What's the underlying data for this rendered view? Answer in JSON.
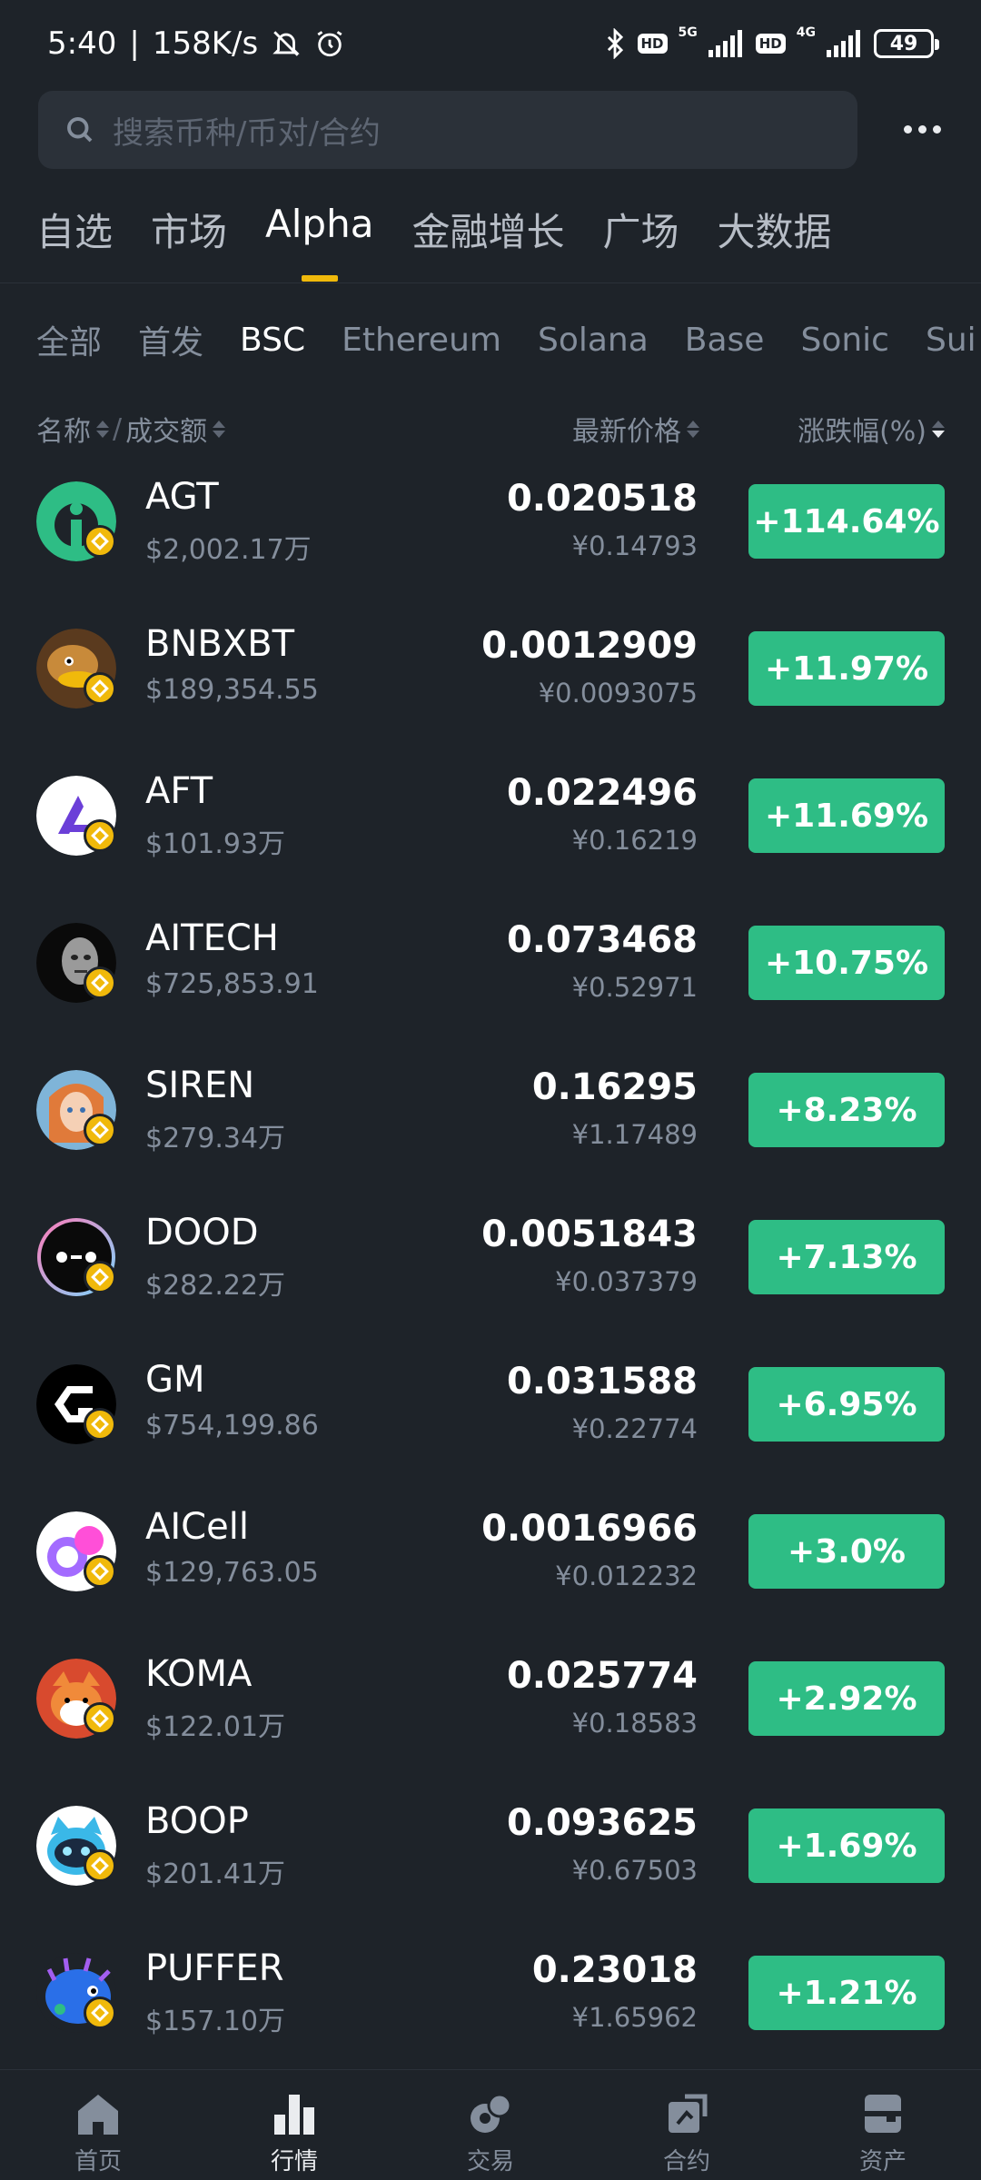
{
  "status_bar": {
    "time": "5:40",
    "speed": "158K/s",
    "hd1": "HD",
    "net1": "5G",
    "hd2": "HD",
    "net2": "4G",
    "battery": "49"
  },
  "search": {
    "placeholder": "搜索币种/币对/合约"
  },
  "main_tabs": [
    "自选",
    "市场",
    "Alpha",
    "金融增长",
    "广场",
    "大数据"
  ],
  "main_tab_active": "Alpha",
  "sub_tabs": [
    "全部",
    "首发",
    "BSC",
    "Ethereum",
    "Solana",
    "Base",
    "Sonic",
    "Sui"
  ],
  "sub_tab_active": "BSC",
  "columns": {
    "name": "名称",
    "sep": "/",
    "volume": "成交额",
    "price": "最新价格",
    "change": "涨跌幅(%)"
  },
  "coins": [
    {
      "symbol": "AGT",
      "volume": "$2,002.17万",
      "price": "0.020518",
      "cny": "¥0.14793",
      "change": "+114.64%"
    },
    {
      "symbol": "BNBXBT",
      "volume": "$189,354.55",
      "price": "0.0012909",
      "cny": "¥0.0093075",
      "change": "+11.97%"
    },
    {
      "symbol": "AFT",
      "volume": "$101.93万",
      "price": "0.022496",
      "cny": "¥0.16219",
      "change": "+11.69%"
    },
    {
      "symbol": "AITECH",
      "volume": "$725,853.91",
      "price": "0.073468",
      "cny": "¥0.52971",
      "change": "+10.75%"
    },
    {
      "symbol": "SIREN",
      "volume": "$279.34万",
      "price": "0.16295",
      "cny": "¥1.17489",
      "change": "+8.23%"
    },
    {
      "symbol": "DOOD",
      "volume": "$282.22万",
      "price": "0.0051843",
      "cny": "¥0.037379",
      "change": "+7.13%"
    },
    {
      "symbol": "GM",
      "volume": "$754,199.86",
      "price": "0.031588",
      "cny": "¥0.22774",
      "change": "+6.95%"
    },
    {
      "symbol": "AICell",
      "volume": "$129,763.05",
      "price": "0.0016966",
      "cny": "¥0.012232",
      "change": "+3.0%"
    },
    {
      "symbol": "KOMA",
      "volume": "$122.01万",
      "price": "0.025774",
      "cny": "¥0.18583",
      "change": "+2.92%"
    },
    {
      "symbol": "BOOP",
      "volume": "$201.41万",
      "price": "0.093625",
      "cny": "¥0.67503",
      "change": "+1.69%"
    },
    {
      "symbol": "PUFFER",
      "volume": "$157.10万",
      "price": "0.23018",
      "cny": "¥1.65962",
      "change": "+1.21%"
    }
  ],
  "bottom_nav": [
    {
      "label": "首页",
      "icon": "home-icon"
    },
    {
      "label": "行情",
      "icon": "markets-icon"
    },
    {
      "label": "交易",
      "icon": "trade-icon"
    },
    {
      "label": "合约",
      "icon": "futures-icon"
    },
    {
      "label": "资产",
      "icon": "wallet-icon"
    }
  ],
  "bottom_nav_active": "行情",
  "colors": {
    "background": "#1e2329",
    "accent": "#f0b90b",
    "positive": "#2ebd85",
    "muted": "#848e9c"
  }
}
